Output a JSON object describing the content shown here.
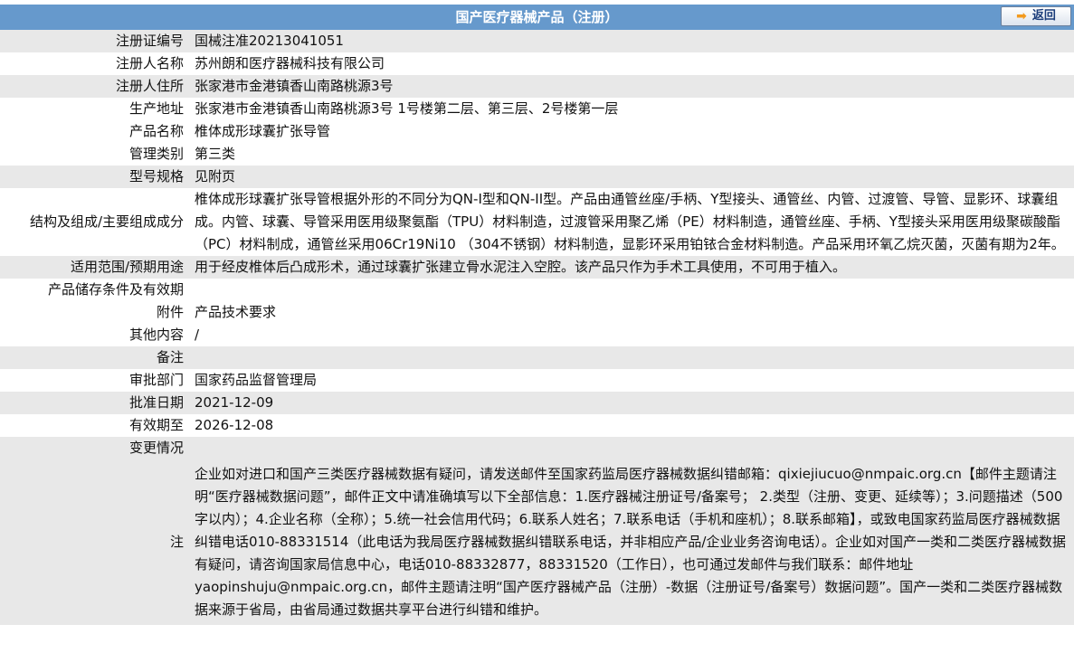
{
  "header": {
    "title": "国产医疗器械产品（注册）",
    "back_label": "返回",
    "back_icon": "arrow-right-icon"
  },
  "rows": [
    {
      "label": "注册证编号",
      "value": "国械注准20213041051"
    },
    {
      "label": "注册人名称",
      "value": "苏州朗和医疗器械科技有限公司"
    },
    {
      "label": "注册人住所",
      "value": "张家港市金港镇香山南路桃源3号"
    },
    {
      "label": "生产地址",
      "value": "张家港市金港镇香山南路桃源3号 1号楼第二层、第三层、2号楼第一层"
    },
    {
      "label": "产品名称",
      "value": "椎体成形球囊扩张导管"
    },
    {
      "label": "管理类别",
      "value": "第三类"
    },
    {
      "label": "型号规格",
      "value": "见附页"
    },
    {
      "label": "结构及组成/主要组成成分",
      "value": "椎体成形球囊扩张导管根据外形的不同分为QN-I型和QN-II型。产品由通管丝座/手柄、Y型接头、通管丝、内管、过渡管、导管、显影环、球囊组成。内管、球囊、导管采用医用级聚氨酯（TPU）材料制造，过渡管采用聚乙烯（PE）材料制造，通管丝座、手柄、Y型接头采用医用级聚碳酸酯（PC）材料制成，通管丝采用06Cr19Ni10 （304不锈钢）材料制造，显影环采用铂铱合金材料制造。产品采用环氧乙烷灭菌，灭菌有期为2年。"
    },
    {
      "label": "适用范围/预期用途",
      "value": "用于经皮椎体后凸成形术，通过球囊扩张建立骨水泥注入空腔。该产品只作为手术工具使用，不可用于植入。"
    },
    {
      "label": "产品储存条件及有效期",
      "value": ""
    },
    {
      "label": "附件",
      "value": "产品技术要求"
    },
    {
      "label": "其他内容",
      "value": "/"
    },
    {
      "label": "备注",
      "value": ""
    },
    {
      "label": "审批部门",
      "value": "国家药品监督管理局"
    },
    {
      "label": "批准日期",
      "value": "2021-12-09"
    },
    {
      "label": "有效期至",
      "value": "2026-12-08"
    },
    {
      "label": "变更情况",
      "value": ""
    }
  ],
  "note": {
    "label": "注",
    "value": "企业如对进口和国产三类医疗器械数据有疑问，请发送邮件至国家药监局医疗器械数据纠错邮箱：qixiejiucuo@nmpaic.org.cn【邮件主题请注明“医疗器械数据问题”，邮件正文中请准确填写以下全部信息：1.医疗器械注册证号/备案号； 2.类型（注册、变更、延续等）；3.问题描述（500字以内）；4.企业名称（全称）；5.统一社会信用代码；6.联系人姓名；7.联系电话（手机和座机）；8.联系邮箱】，或致电国家药监局医疗器械数据纠错电话010-88331514（此电话为我局医疗器械数据纠错联系电话，并非相应产品/企业业务咨询电话）。企业如对国产一类和二类医疗器械数据有疑问，请咨询国家局信息中心，电话010-88332877，88331520（工作日），也可通过发邮件与我们联系：邮件地址yaopinshuju@nmpaic.org.cn，邮件主题请注明“国产医疗器械产品（注册）-数据（注册证号/备案号）数据问题”。国产一类和二类医疗器械数据来源于省局，由省局通过数据共享平台进行纠错和维护。"
  }
}
